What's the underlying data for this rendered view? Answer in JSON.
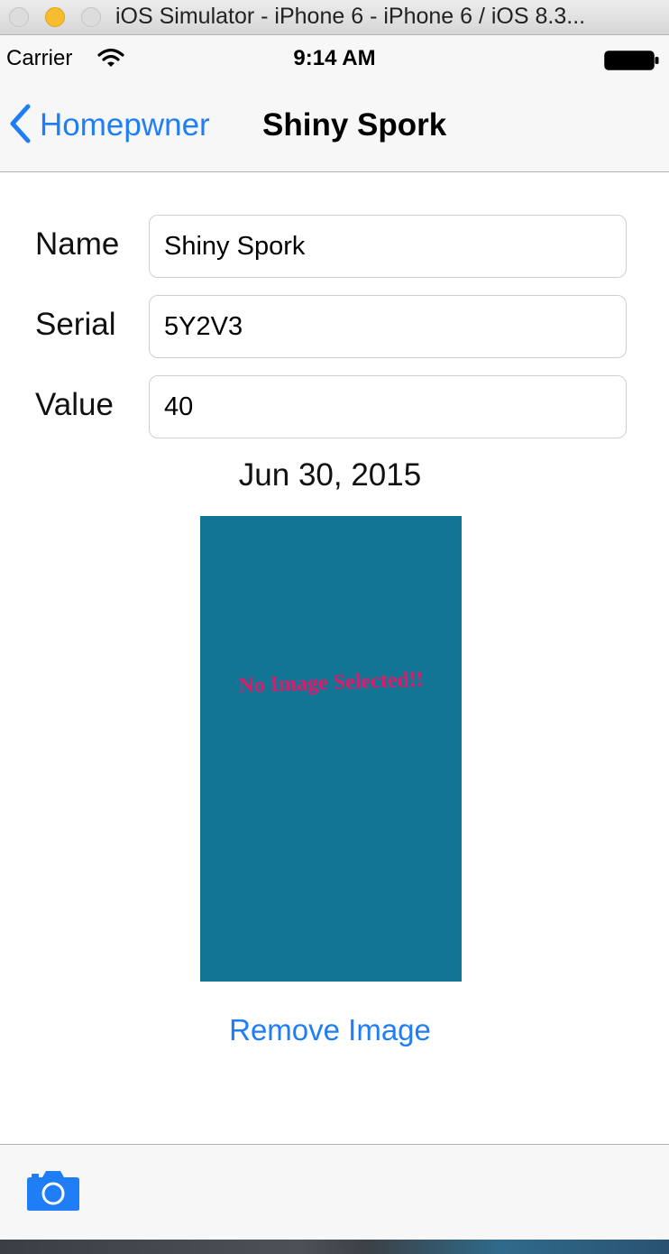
{
  "window": {
    "title": "iOS Simulator - iPhone 6 - iPhone 6 / iOS 8.3..."
  },
  "status_bar": {
    "carrier": "Carrier",
    "time": "9:14 AM"
  },
  "nav": {
    "back_label": "Homepwner",
    "title": "Shiny Spork"
  },
  "form": {
    "name_label": "Name",
    "name_value": "Shiny Spork",
    "serial_label": "Serial",
    "serial_value": "5Y2V3",
    "value_label": "Value",
    "value_value": "40"
  },
  "date": "Jun 30, 2015",
  "image": {
    "placeholder_text": "No Image Selected!!",
    "background": "#127593",
    "text_color": "#e01a6a"
  },
  "remove_image_label": "Remove Image",
  "colors": {
    "tint": "#1f7ef5"
  },
  "icons": {
    "back": "chevron-left-icon",
    "camera": "camera-icon",
    "wifi": "wifi-icon",
    "battery": "battery-icon"
  }
}
